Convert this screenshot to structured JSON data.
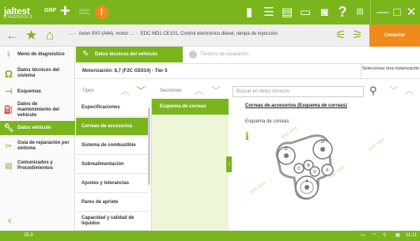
{
  "app": {
    "logo": "jaltest",
    "logo_sub": "DIAGNOSIS",
    "group": "GRP",
    "small_badge": "SMART DIESEL"
  },
  "topbar_icons": [
    "screen-icon",
    "list-icon",
    "print-icon",
    "printer-icon",
    "camera-icon",
    "help-icon",
    "grid-icon",
    "minimize-icon",
    "maximize-icon",
    "close-icon"
  ],
  "nav": {
    "breadcrumb": [
      "...",
      "Axion 9X0 (A64), motor: ...",
      "EDC MD1 CE101, Control electrónico diésel, rampa de inyección"
    ],
    "connect_label": "Conectar"
  },
  "sidebar": {
    "items": [
      {
        "label": "Menú de diagnóstico",
        "icon": "diagnosis-icon"
      },
      {
        "label": "Datos técnicos del sistema",
        "icon": "omega-icon"
      },
      {
        "label": "Esquemas",
        "icon": "schema-icon"
      },
      {
        "label": "Datos de mantenimiento del vehículo",
        "icon": "maintenance-icon"
      },
      {
        "label": "Datos vehículo",
        "icon": "wrench-icon"
      },
      {
        "label": "Guía de reparación por síntoma",
        "icon": "repair-guide-icon"
      },
      {
        "label": "Comunicados y Procedimientos",
        "icon": "document-icon"
      }
    ],
    "active_index": 4
  },
  "tabs": {
    "active": "Datos técnicos del vehículo",
    "inactive": "Tiempos de reparación"
  },
  "motor": {
    "label": "Motorización:",
    "value": "8,7 (F2C GE614) - Tier 5",
    "select_other": "Seleccionar otra motorización"
  },
  "columns": {
    "tipos": "Tipos",
    "secciones": "Secciones"
  },
  "tipos": [
    "Especificaciones",
    "Correas de accesorios",
    "Sistema de combustible",
    "Sobrealimentación",
    "Ajustes y tolerancias",
    "Pares de apriete",
    "Capacidad y calidad de líquidos"
  ],
  "tipos_active_index": 1,
  "secciones": [
    "Esquema de correas"
  ],
  "search": {
    "placeholder": "Buscar en datos técnicos"
  },
  "content": {
    "title": "Correas de accesorios (Esquema de correas)",
    "subtitle": "Esquema de correas",
    "pulleys": [
      "G",
      "E",
      "C",
      "B",
      "D",
      "F",
      "A"
    ]
  },
  "status": {
    "version": "25.3",
    "time": "11:11"
  },
  "colors": {
    "accent": "#7ab51d",
    "orange": "#f08a1c"
  }
}
